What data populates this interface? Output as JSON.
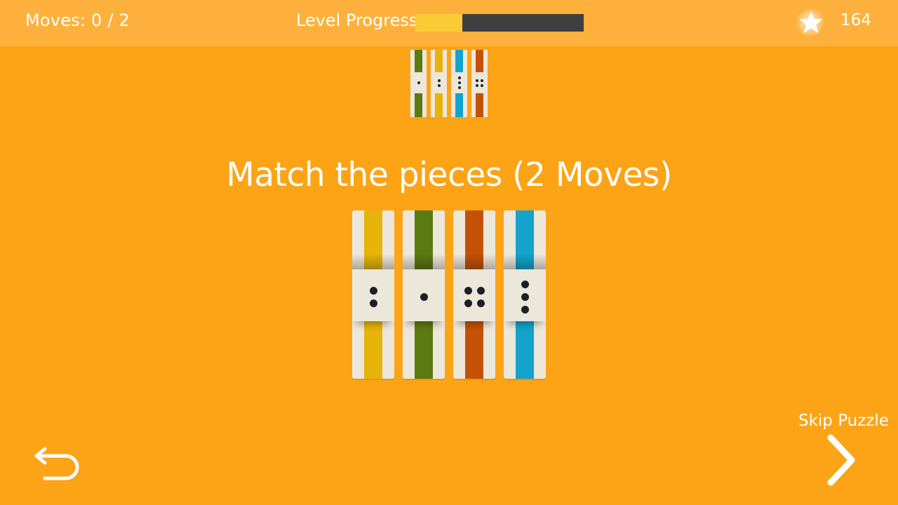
{
  "hud": {
    "moves_label": "Moves: 0 / 2",
    "level_progress_label": "Level Progress",
    "level_progress_fraction": 0.28,
    "star_icon": "star-icon",
    "star_count": "164"
  },
  "target_pattern": [
    {
      "color": "#5C7A12",
      "pips": 1
    },
    {
      "color": "#E6B40A",
      "pips": 2
    },
    {
      "color": "#13A3CC",
      "pips": 3
    },
    {
      "color": "#C45206",
      "pips": 4
    }
  ],
  "instruction": "Match the pieces (2 Moves)",
  "pieces": [
    {
      "color": "#E6B40A",
      "pips": 2
    },
    {
      "color": "#5C7A12",
      "pips": 1
    },
    {
      "color": "#C45206",
      "pips": 4
    },
    {
      "color": "#13A3CC",
      "pips": 3
    }
  ],
  "controls": {
    "skip_label": "Skip Puzzle",
    "skip_icon": "chevron-right-icon",
    "back_icon": "undo-arrow-icon"
  },
  "colors": {
    "background": "#FCA316",
    "topbar": "#FDB13C",
    "progress_fill": "#FBCB36",
    "progress_track": "#3F3F3F",
    "piece_base": "#ECE7DB"
  }
}
